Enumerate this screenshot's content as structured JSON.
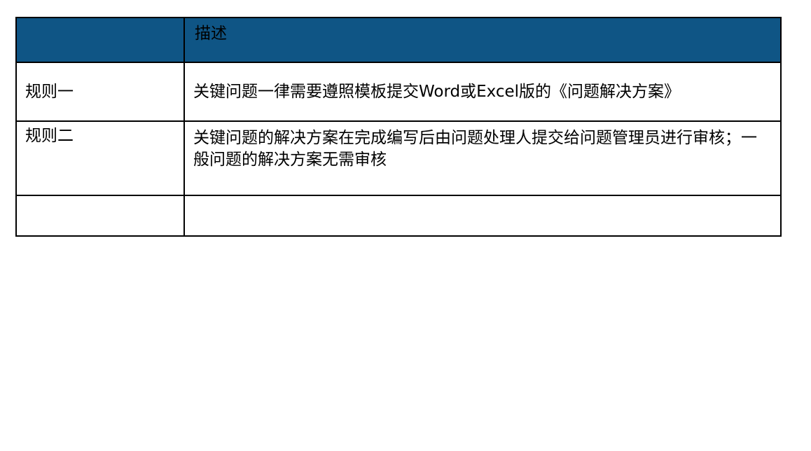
{
  "table": {
    "header": {
      "col1": "",
      "col2": "描述"
    },
    "rows": [
      {
        "name": "规则一",
        "description": "关键问题一律需要遵照模板提交Word或Excel版的《问题解决方案》"
      },
      {
        "name": "规则二",
        "description": "关键问题的解决方案在完成编写后由问题处理人提交给问题管理员进行审核；一般问题的解决方案无需审核"
      },
      {
        "name": "",
        "description": ""
      }
    ],
    "header_color": "#0f5585",
    "border_color": "#000000"
  }
}
